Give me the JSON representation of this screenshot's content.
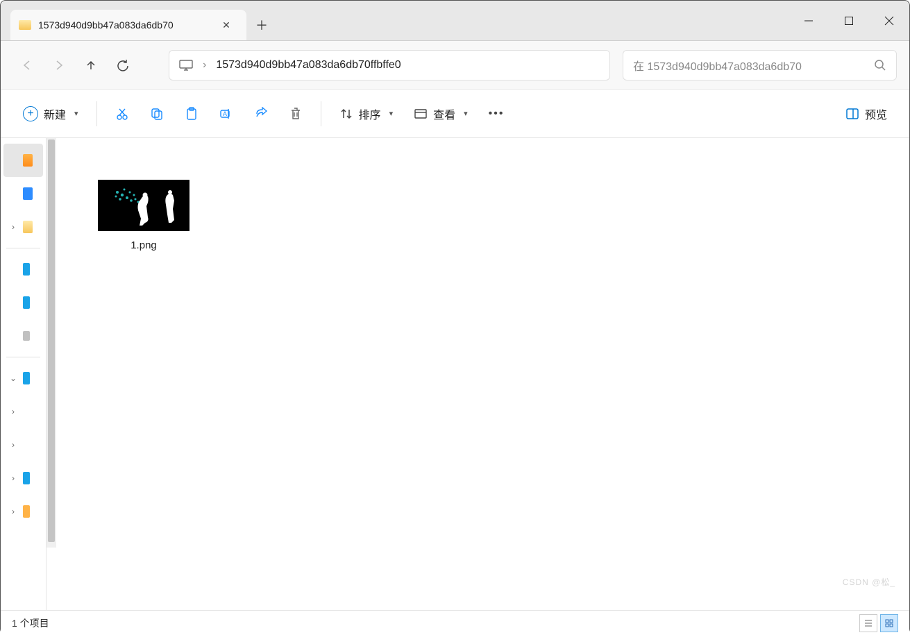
{
  "tab": {
    "title": "1573d940d9bb47a083da6db70"
  },
  "address": {
    "path": "1573d940d9bb47a083da6db70ffbffe0"
  },
  "search": {
    "placeholder": "在 1573d940d9bb47a083da6db70"
  },
  "toolbar": {
    "new_label": "新建",
    "sort_label": "排序",
    "view_label": "查看",
    "preview_label": "预览"
  },
  "files": [
    {
      "name": "1.png"
    }
  ],
  "status": {
    "item_count": "1 个项目"
  },
  "watermark": "CSDN @松_"
}
